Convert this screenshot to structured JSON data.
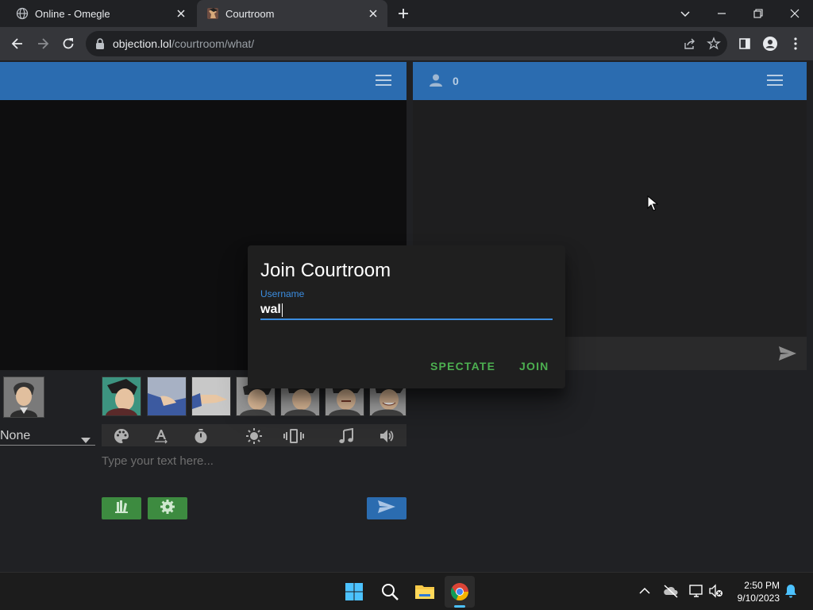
{
  "browser": {
    "tabs": [
      {
        "title": "Online - Omegle"
      },
      {
        "title": "Courtroom"
      }
    ],
    "url_host": "objection.lol",
    "url_path": "/courtroom/what/"
  },
  "chat": {
    "user_count": "0",
    "message_placeholder": ""
  },
  "composer": {
    "character_select_value": "None",
    "text_placeholder": "Type your text here..."
  },
  "dialog": {
    "title": "Join Courtroom",
    "username_label": "Username",
    "username_value": "wal",
    "spectate_label": "SPECTATE",
    "join_label": "JOIN"
  },
  "taskbar": {
    "time": "2:50 PM",
    "date": "9/10/2023"
  },
  "colors": {
    "header_blue": "#2b6cb0",
    "accent_green": "#4caf50",
    "input_underline": "#3b8de0"
  }
}
